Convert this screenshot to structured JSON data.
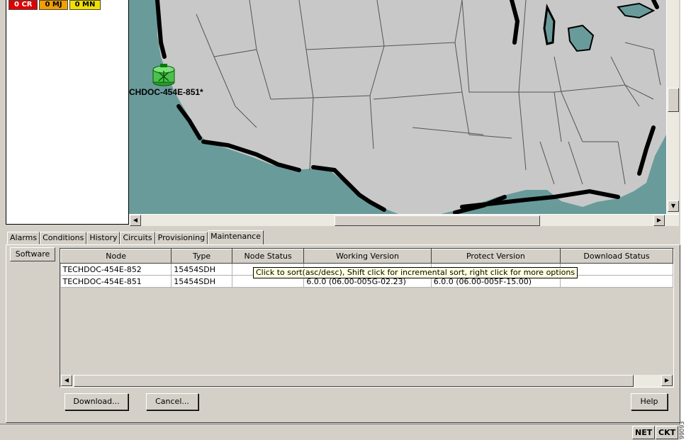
{
  "alarms": [
    {
      "label": "0 CR",
      "color": "#e00000",
      "text_color": "#ffffff"
    },
    {
      "label": "0 MJ",
      "color": "#f0a000",
      "text_color": "#000000"
    },
    {
      "label": "0 MN",
      "color": "#f0e000",
      "text_color": "#000000"
    }
  ],
  "map": {
    "node_label": "CHDOC-454E-851*",
    "node_icon": "network-node-icon"
  },
  "tabs": [
    "Alarms",
    "Conditions",
    "History",
    "Circuits",
    "Provisioning",
    "Maintenance"
  ],
  "active_tab": "Maintenance",
  "subtab": "Software",
  "table": {
    "columns": [
      "Node",
      "Type",
      "Node Status",
      "Working Version",
      "Protect Version",
      "Download Status"
    ],
    "rows": [
      [
        "TECHDOC-454E-852",
        "15454SDH",
        "",
        "",
        "",
        ""
      ],
      [
        "TECHDOC-454E-851",
        "15454SDH",
        "",
        "6.0.0 (06.00-005G-02.23)",
        "6.0.0 (06.00-005F-15.00)",
        ""
      ]
    ]
  },
  "tooltip": "Click to sort(asc/desc), Shift click for incremental sort, right click for more options",
  "buttons": {
    "download": "Download...",
    "cancel": "Cancel...",
    "help": "Help"
  },
  "status_buttons": {
    "net": "NET",
    "ckt": "CKT"
  },
  "colors": {
    "ocean": "#6a9b9b",
    "land": "#c8c8c8",
    "coast": "#000000",
    "tooltip_bg": "#ffffe1"
  },
  "side_code": "99093"
}
